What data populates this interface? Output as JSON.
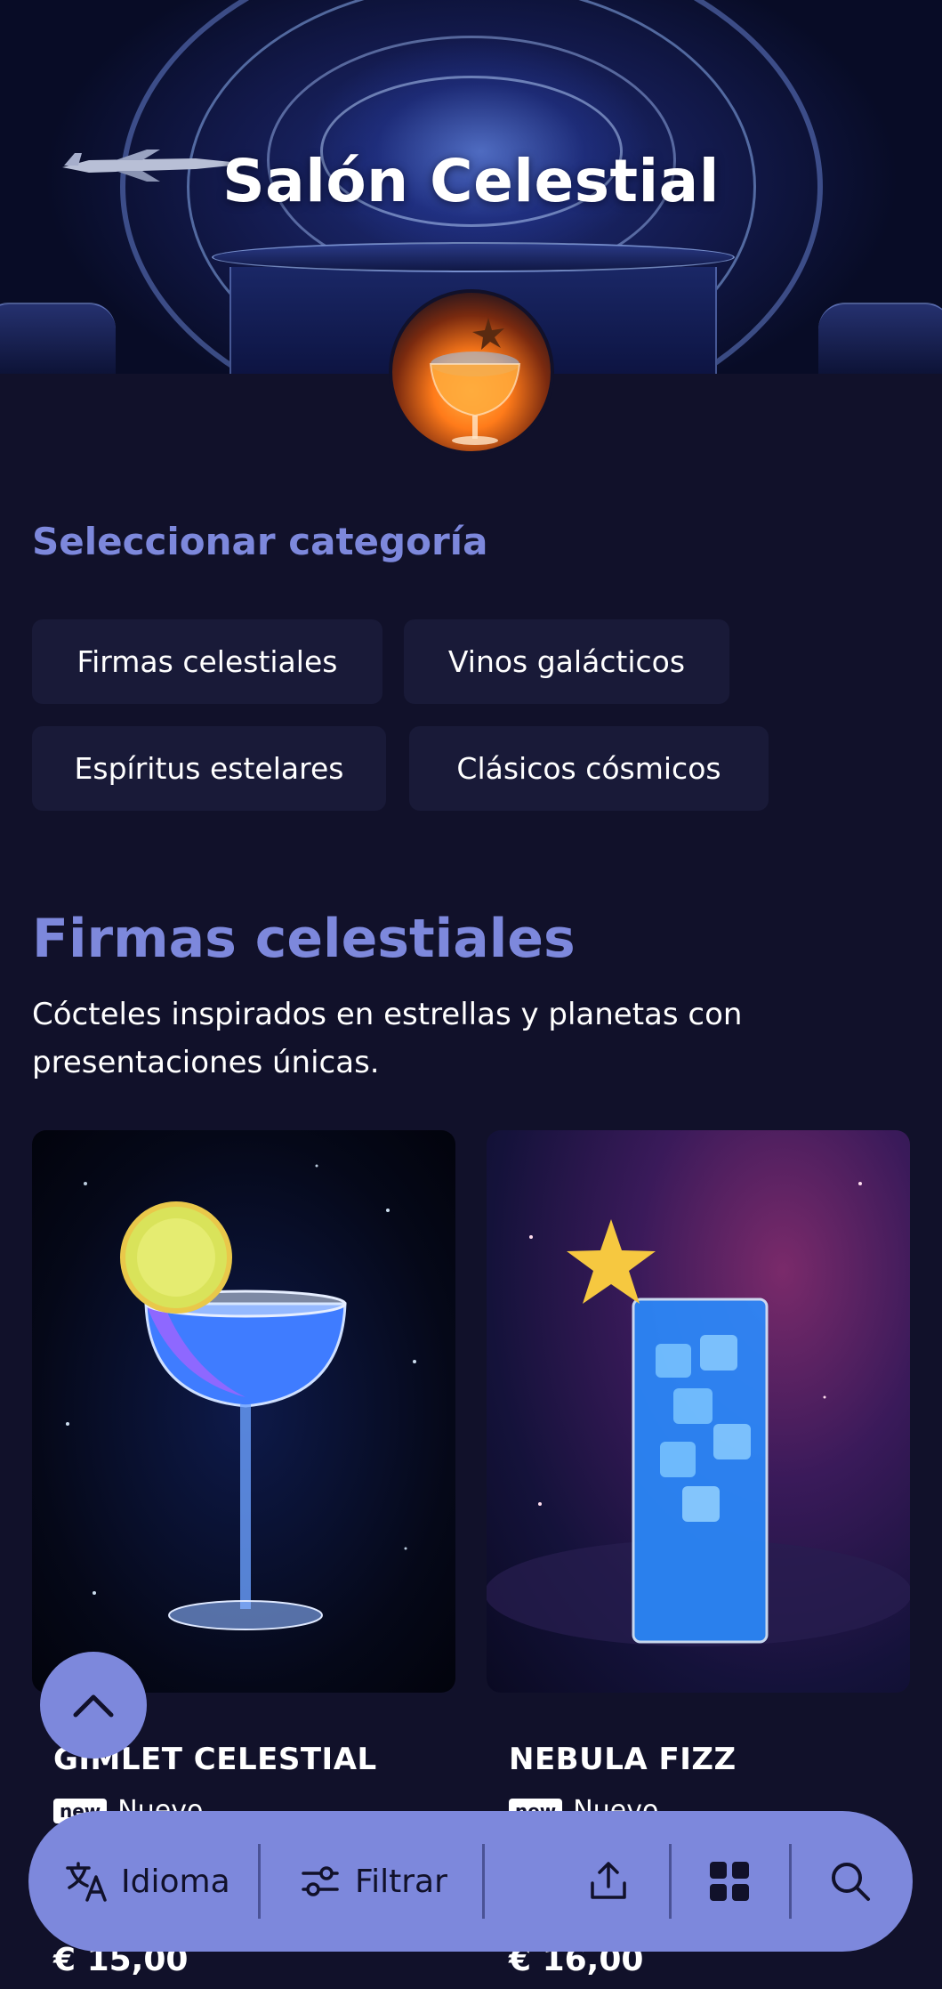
{
  "hero": {
    "title": "Salón Celestial"
  },
  "categories": {
    "heading": "Seleccionar categoría",
    "chips": [
      "Firmas celestiales",
      "Vinos galácticos",
      "Espíritus estelares",
      "Clásicos cósmicos"
    ]
  },
  "section": {
    "title": "Firmas celestiales",
    "description": "Cócteles inspirados en estrellas y planetas con presentaciones únicas."
  },
  "products": [
    {
      "name": "GIMLET CELESTIAL",
      "badge": "new",
      "badge_text": "Nuevo",
      "price": "€ 15,00"
    },
    {
      "name": "NEBULA FIZZ",
      "badge": "new",
      "badge_text": "Nuevo",
      "price": "€ 16,00"
    }
  ],
  "bottom_bar": {
    "language_label": "Idioma",
    "filter_label": "Filtrar",
    "icons": [
      "translate-icon",
      "filter-icon",
      "share-icon",
      "grid-icon",
      "search-icon"
    ]
  },
  "colors": {
    "accent": "#7d88dc",
    "background": "#11112a",
    "chip_background": "#191a38"
  }
}
